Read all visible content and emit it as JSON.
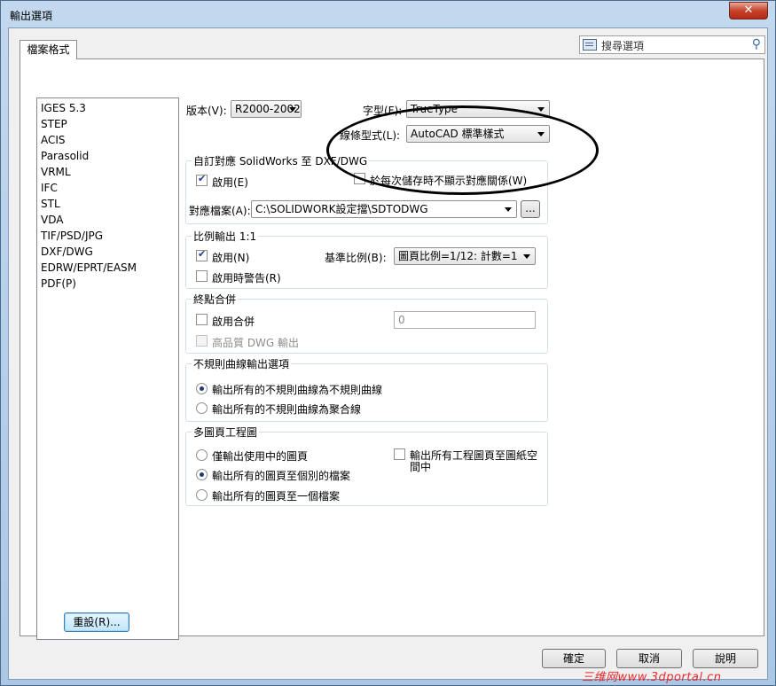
{
  "window": {
    "title": "輸出選項",
    "close_glyph": "✕"
  },
  "search": {
    "placeholder": "搜尋選項"
  },
  "tab": {
    "label": "檔案格式"
  },
  "file_types": [
    "IGES 5.3",
    "STEP",
    "ACIS",
    "Parasolid",
    "VRML",
    "IFC",
    "STL",
    "VDA",
    "TIF/PSD/JPG",
    "DXF/DWG",
    "EDRW/EPRT/EASM",
    "PDF(P)"
  ],
  "version": {
    "label": "版本(V):",
    "value": "R2000-2002"
  },
  "font": {
    "label": "字型(F):",
    "value": "TrueType"
  },
  "linestyle": {
    "label": "線條型式(L):",
    "value": "AutoCAD 標準樣式"
  },
  "mapping": {
    "title": "自訂對應 SolidWorks 至 DXF/DWG",
    "enable_label": "啟用(E)",
    "enable_checked": true,
    "no_show_label": "於每次儲存時不顯示對應關係(W)",
    "no_show_checked": false,
    "file_label": "對應檔案(A):",
    "file_value": "C:\\SOLIDWORK設定擋\\SDTODWG",
    "browse_label": "..."
  },
  "scale": {
    "title": "比例輸出 1:1",
    "enable_label": "啟用(N)",
    "enable_checked": true,
    "warn_label": "啟用時警告(R)",
    "warn_checked": false,
    "base_label": "基準比例(B):",
    "base_value": "圖頁比例=1/12: 計數=1"
  },
  "endpoint": {
    "title": "終點合併",
    "enable_label": "啟用合併",
    "enable_checked": false,
    "value": "0",
    "hq_label": "高品質 DWG 輸出"
  },
  "spline": {
    "title": "不規則曲線輸出選項",
    "option1": "輸出所有的不規則曲線為不規則曲線",
    "option2": "輸出所有的不規則曲線為聚合線",
    "selected": 1
  },
  "multisheet": {
    "title": "多圖頁工程圖",
    "option1": "僅輸出使用中的圖頁",
    "option2": "輸出所有的圖頁至個別的檔案",
    "option3": "輸出所有的圖頁至一個檔案",
    "selected": 2,
    "paperspace_label_line1": "輸出所有工程圖頁至圖紙空",
    "paperspace_label_line2": "間中"
  },
  "buttons": {
    "reset": "重設(R)...",
    "ok": "確定",
    "cancel": "取消",
    "help": "說明"
  },
  "watermark": "三维网www.3dportal.cn"
}
